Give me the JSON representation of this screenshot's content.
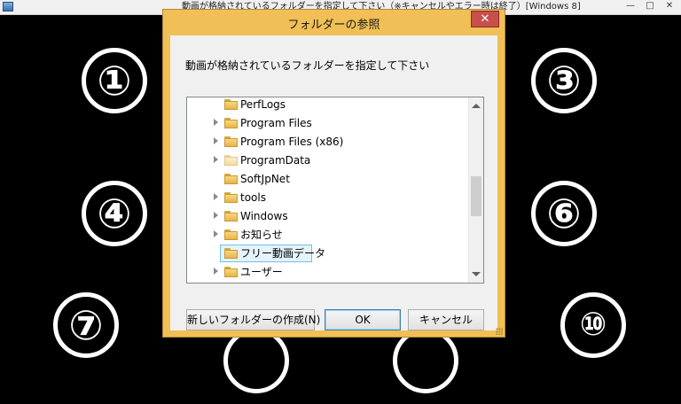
{
  "app": {
    "title": "動画が格納されているフォルダーを指定して下さい（※キャンセルやエラー時は終了）[Windows 8]",
    "minimize_glyph": "—",
    "maximize_glyph": "□",
    "close_glyph": "✕"
  },
  "background_numerals": [
    "①",
    "③",
    "④",
    "⑥",
    "⑦",
    "⑩"
  ],
  "dialog": {
    "title": "フォルダーの参照",
    "close_glyph": "✕",
    "message": "動画が格納されているフォルダーを指定して下さい",
    "tree": {
      "items": [
        {
          "label": "PerfLogs",
          "expandable": false,
          "selected": false,
          "pale": false
        },
        {
          "label": "Program Files",
          "expandable": true,
          "selected": false,
          "pale": false
        },
        {
          "label": "Program Files (x86)",
          "expandable": true,
          "selected": false,
          "pale": false
        },
        {
          "label": "ProgramData",
          "expandable": true,
          "selected": false,
          "pale": true
        },
        {
          "label": "SoftJpNet",
          "expandable": false,
          "selected": false,
          "pale": false
        },
        {
          "label": "tools",
          "expandable": true,
          "selected": false,
          "pale": false
        },
        {
          "label": "Windows",
          "expandable": true,
          "selected": false,
          "pale": false
        },
        {
          "label": "お知らせ",
          "expandable": true,
          "selected": false,
          "pale": false
        },
        {
          "label": "フリー動画データ",
          "expandable": false,
          "selected": true,
          "pale": false
        },
        {
          "label": "ユーザー",
          "expandable": true,
          "selected": false,
          "pale": false
        }
      ],
      "scroll_position": 0.55
    },
    "buttons": {
      "new_folder": "新しいフォルダーの作成(N)",
      "ok": "OK",
      "cancel": "キャンセル"
    }
  }
}
